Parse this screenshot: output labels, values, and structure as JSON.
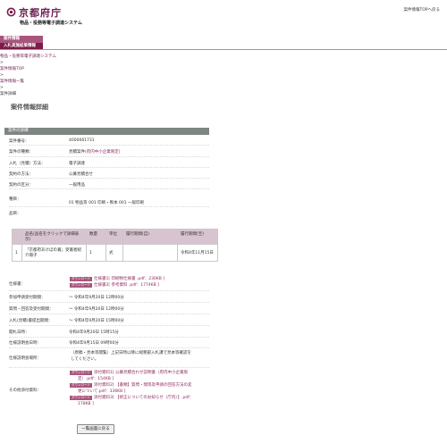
{
  "header": {
    "logo_text": "京都府庁",
    "system_name": "物品・役務等電子調達システム",
    "top_link": "案件情報TOPへ戻る"
  },
  "nav": {
    "items": [
      {
        "label": "案件情報"
      },
      {
        "label": "入札実施結果情報"
      }
    ]
  },
  "breadcrumb": {
    "items": [
      "物品・役務等電子調達システム",
      "案件情報TOP",
      "案件情報一覧",
      "案件詳細"
    ],
    "separator": ">"
  },
  "page_title": "案件情報詳細",
  "section_title": "案件の詳細",
  "details": {
    "case_no": {
      "label": "案件番号：",
      "value": "4000061731"
    },
    "case_type": {
      "label": "案件の種類：",
      "value": "見積案件",
      "extra": "(府内中小企業限定)"
    },
    "bid_method": {
      "label": "入札（見積）方法：",
      "value": "電子調達"
    },
    "contract_method": {
      "label": "契約の方法：",
      "value": "公募見積合せ"
    },
    "contract_category": {
      "label": "契約の区分：",
      "value": "一般用品"
    },
    "type": {
      "label": "種目：",
      "value": "01 物品等 001 印刷・製本 001 一般印刷"
    },
    "item_label": "品目："
  },
  "items_table": {
    "headers": [
      "品名(品名をクリックで詳細表示)",
      "数量",
      "単位",
      "履行期間(自)",
      "履行期間(至)"
    ],
    "rows": [
      {
        "no": "1",
        "name": "「京都府あけぼの賞」受賞者紹介冊子",
        "qty": "1",
        "unit": "式",
        "from": "",
        "to": "令和4年11月15日"
      }
    ]
  },
  "spec": {
    "label": "仕様書：",
    "download_label": "ダウンロード",
    "files": [
      "仕様書1[ 印刷物仕様書 .pdf：230KB ]",
      "仕様書2[ 参考資料 .pdf：1774KB ]"
    ]
  },
  "schedule": [
    {
      "label": "参加申請受付期間：",
      "value": "～ 令和4年9月20日 12時00分"
    },
    {
      "label": "質問・回答及受付期間：",
      "value": "～ 令和4年9月20日 12時00分"
    },
    {
      "label": "入札(見積)書提出期間：",
      "value": "～ 令和4年9月20日 15時00分"
    },
    {
      "label": "開札日時：",
      "value": "令和4年9月20日 15時15分"
    },
    {
      "label": "仕様説明会日時：",
      "value": "令和4年9月15日 09時00分"
    }
  ],
  "venue": {
    "label": "仕様説明会場所：",
    "lines": [
      "（原稿・見本等閲覧）上記日時以降に総務部入札課で見本等確認を",
      "してください。"
    ]
  },
  "other": {
    "label": "その他添付資料：",
    "files": [
      {
        "text": "添付資料1[ 公募見積合わせ説明書（府内中小企業限",
        "cont": "定）.pdf：154KB ]"
      },
      {
        "text": "添付資料2[ 【書類】質問・間等及申請の回答方法の変",
        "cont": "更について.pdf：336KB ]"
      },
      {
        "text": "添付資料3[ 【修正についてのお知らせ（庁内）】.pdf：",
        "cont": "178KB ]"
      }
    ]
  },
  "back_button": "一覧画面に戻る"
}
